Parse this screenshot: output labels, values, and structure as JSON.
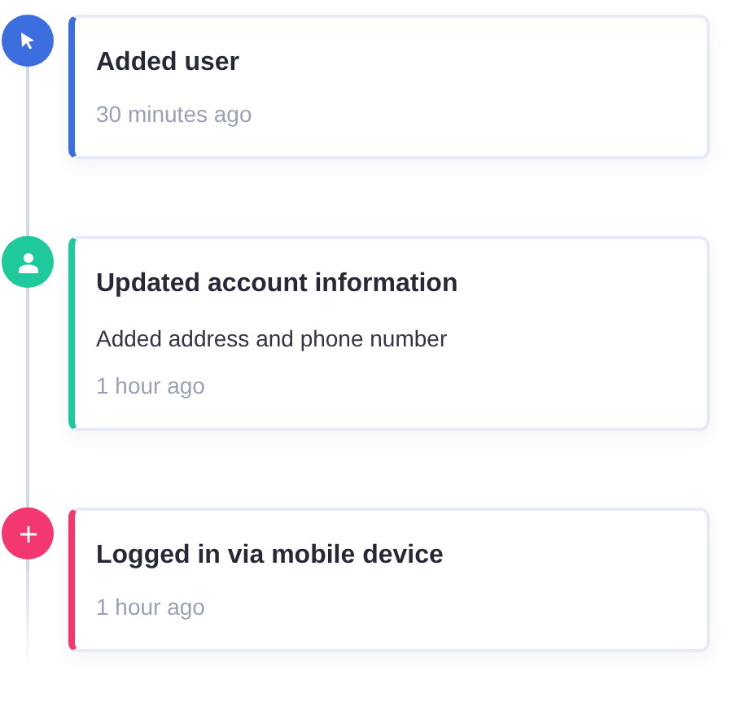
{
  "timeline": [
    {
      "kind": "cursor",
      "color": "#3d6ee0",
      "title": "Added user",
      "time": "30 minutes ago"
    },
    {
      "kind": "person",
      "color": "#1ec99c",
      "title": "Updated account information",
      "description": "Added address and phone number",
      "time": "1 hour ago"
    },
    {
      "kind": "plus",
      "color": "#f2386e",
      "title": "Logged in via mobile device",
      "time": "1 hour ago"
    }
  ]
}
